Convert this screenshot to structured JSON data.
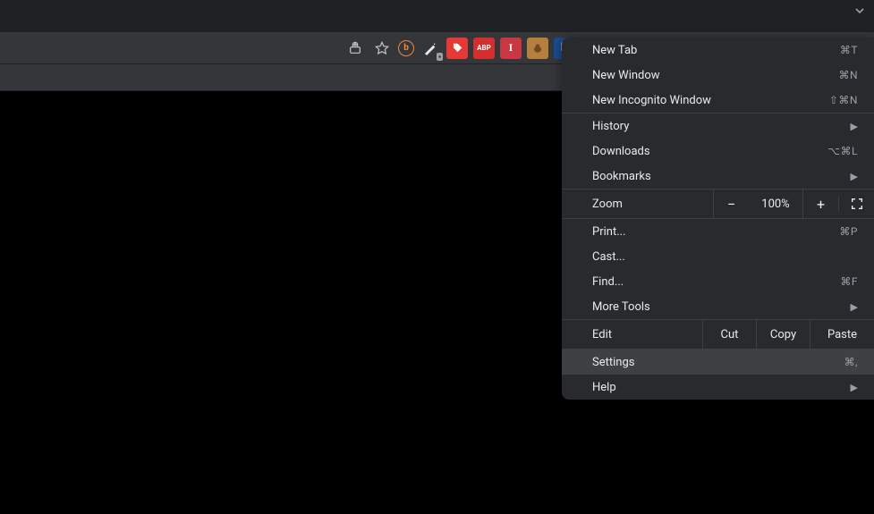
{
  "menu": {
    "section1": [
      {
        "label": "New Tab",
        "shortcut": "⌘T"
      },
      {
        "label": "New Window",
        "shortcut": "⌘N"
      },
      {
        "label": "New Incognito Window",
        "shortcut": "⇧⌘N"
      }
    ],
    "section2": [
      {
        "label": "History",
        "submenu": true
      },
      {
        "label": "Downloads",
        "shortcut": "⌥⌘L"
      },
      {
        "label": "Bookmarks",
        "submenu": true
      }
    ],
    "zoom": {
      "label": "Zoom",
      "value": "100%"
    },
    "section3": [
      {
        "label": "Print...",
        "shortcut": "⌘P"
      },
      {
        "label": "Cast..."
      },
      {
        "label": "Find...",
        "shortcut": "⌘F"
      },
      {
        "label": "More Tools",
        "submenu": true
      }
    ],
    "edit": {
      "label": "Edit",
      "cut": "Cut",
      "copy": "Copy",
      "paste": "Paste"
    },
    "settings": {
      "label": "Settings",
      "shortcut": "⌘,"
    },
    "help": {
      "label": "Help",
      "submenu": true
    }
  },
  "toolbar": {
    "icons": [
      {
        "name": "share",
        "bg": "transparent",
        "fg": "#c4c7c5"
      },
      {
        "name": "star",
        "bg": "transparent",
        "fg": "#c4c7c5"
      },
      {
        "name": "ext-b",
        "bg": "transparent",
        "fg": "#f0883b"
      },
      {
        "name": "ext-wand",
        "bg": "transparent",
        "fg": "#e8eaed"
      },
      {
        "name": "ext-tag",
        "bg": "#e53935",
        "fg": "#fff"
      },
      {
        "name": "ext-abp",
        "bg": "#d32f2f",
        "fg": "#fff"
      },
      {
        "name": "ext-i",
        "bg": "#c93742",
        "fg": "#fff"
      },
      {
        "name": "ext-animal",
        "bg": "#b57f3d",
        "fg": "#fff"
      },
      {
        "name": "ext-p",
        "bg": "#1a73e8",
        "fg": "#fff"
      },
      {
        "name": "ext-heart",
        "bg": "transparent",
        "fg": "#4dd0e1"
      },
      {
        "name": "ext-figure",
        "bg": "#e8eaed",
        "fg": "#5f6368"
      },
      {
        "name": "ext-1b",
        "bg": "#5f6368",
        "fg": "#e8eaed"
      },
      {
        "name": "ext-e",
        "bg": "#7c4dff",
        "fg": "#fff"
      },
      {
        "name": "ext-link",
        "bg": "#29b6f6",
        "fg": "#fff"
      },
      {
        "name": "ext-download",
        "bg": "#202124",
        "fg": "#e8eaed"
      },
      {
        "name": "extensions",
        "bg": "transparent",
        "fg": "#e8eaed"
      },
      {
        "name": "ext-media",
        "bg": "transparent",
        "fg": "#e8eaed"
      },
      {
        "name": "sidepanel",
        "bg": "transparent",
        "fg": "#e8eaed"
      }
    ]
  }
}
